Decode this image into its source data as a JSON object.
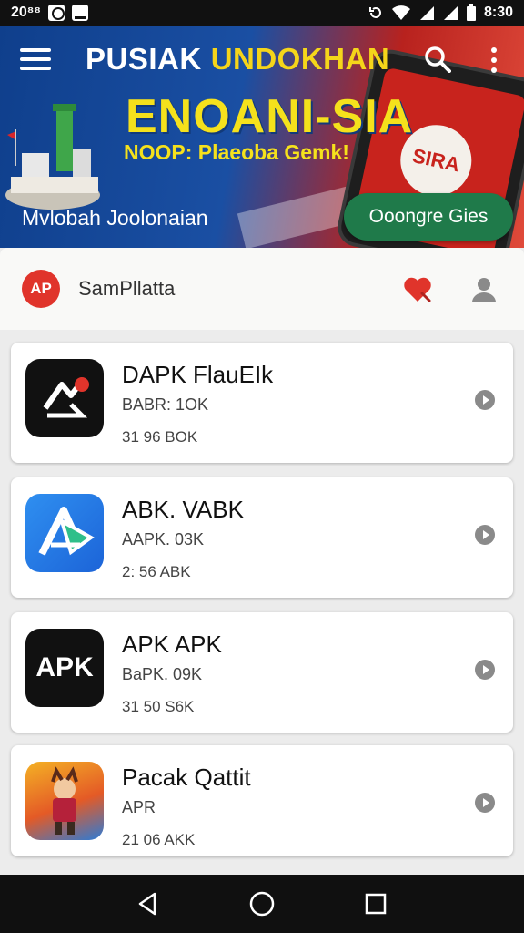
{
  "status_bar": {
    "left_text": "20⁸⁸",
    "time": "8:30"
  },
  "banner": {
    "title_white": "PUSIAK",
    "title_yellow": "UNDOKHAN",
    "headline": "ENOANI-SIA",
    "subline": "NOOP: Plaeoba Gemk!",
    "tagline": "Mvlobah Joolonaian",
    "cta_label": "Ooongre Gies",
    "phone_badge": "SIRA"
  },
  "section": {
    "logo_text": "AP",
    "title": "SamPllatta"
  },
  "apps": [
    {
      "name": "DAPK FlauEIk",
      "meta1": "BABR: 1OK",
      "meta2": "31 96  BOK"
    },
    {
      "name": "ABK. VABK",
      "meta1": "AAPK. 03K",
      "meta2": "2:  56  ABK"
    },
    {
      "name": "APK APK",
      "meta1": "BaPK. 09K",
      "meta2": "31 50  S6K",
      "icon_text": "APK"
    },
    {
      "name": "Pacak Qattit",
      "meta1": "APR",
      "meta2": "21 06  AKK"
    }
  ],
  "colors": {
    "accent_yellow": "#f5e11c",
    "cta_green": "#1f7a4a",
    "logo_red": "#e0342b"
  }
}
